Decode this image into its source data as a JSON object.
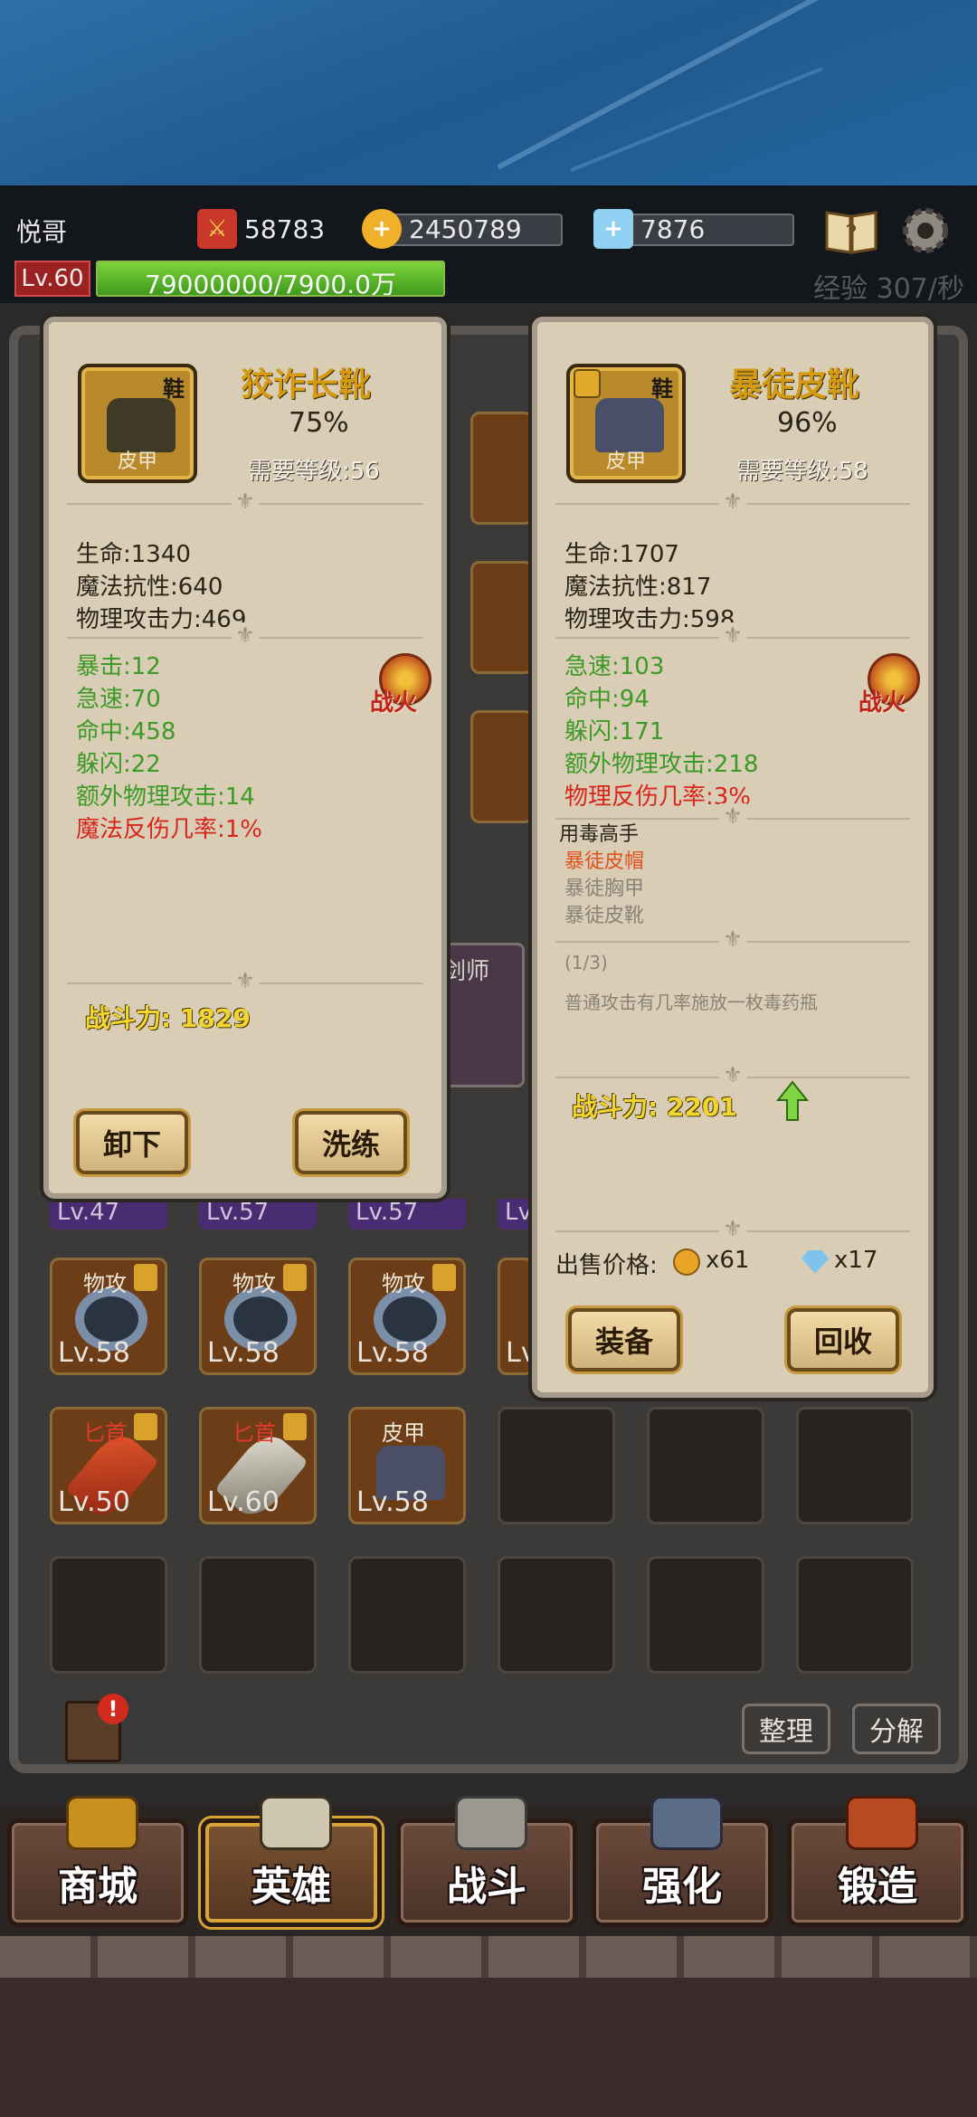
{
  "player": {
    "name": "悦哥",
    "level": "Lv.60",
    "exp_text": "79000000/7900.0万",
    "exp_fraction": 1.0,
    "exp_rate": "经验 307/秒"
  },
  "resources": {
    "power": "58783",
    "gold": "2450789",
    "diamond": "7876"
  },
  "left_card": {
    "title": "狡诈长靴",
    "percent": "75%",
    "required_level": "需要等级:56",
    "slot": "鞋",
    "type": "皮甲",
    "base_stats": [
      "生命:1340",
      "魔法抗性:640",
      "物理攻击力:469"
    ],
    "bonus_stats": [
      "暴击:12",
      "急速:70",
      "命中:458",
      "躲闪:22",
      "额外物理攻击:14"
    ],
    "red_stats": [
      "魔法反伤几率:1%"
    ],
    "fire_label": "战火",
    "power": "战斗力: 1829",
    "buttons": {
      "unequip": "卸下",
      "refine": "洗练"
    }
  },
  "right_card": {
    "title": "暴徒皮靴",
    "percent": "96%",
    "required_level": "需要等级:58",
    "slot": "鞋",
    "type": "皮甲",
    "base_stats": [
      "生命:1707",
      "魔法抗性:817",
      "物理攻击力:598"
    ],
    "bonus_stats": [
      "急速:103",
      "命中:94",
      "躲闪:171",
      "额外物理攻击:218"
    ],
    "red_stats": [
      "物理反伤几率:3%"
    ],
    "fire_label": "战火",
    "set": {
      "name": "用毒高手",
      "pieces": [
        "暴徒皮帽",
        "暴徒胸甲",
        "暴徒皮靴"
      ],
      "progress": "(1/3)",
      "effect": "普通攻击有几率施放一枚毒药瓶"
    },
    "power": "战斗力: 2201",
    "sell_label": "出售价格:",
    "sell_gold": "x61",
    "sell_diamond": "x17",
    "buttons": {
      "equip": "装备",
      "recycle": "回收"
    }
  },
  "inventory": {
    "level_tabs": [
      "Lv.47",
      "Lv.57",
      "Lv.57",
      "Lv"
    ],
    "row1": [
      {
        "tag": "物攻",
        "level": "Lv.58",
        "locked": true
      },
      {
        "tag": "物攻",
        "level": "Lv.58",
        "locked": true
      },
      {
        "tag": "物攻",
        "level": "Lv.58",
        "locked": true
      },
      {
        "tag": "",
        "level": "Lv",
        "locked": false
      }
    ],
    "row2": [
      {
        "tag": "匕首",
        "level": "Lv.50",
        "locked": true
      },
      {
        "tag": "匕首",
        "level": "Lv.60",
        "locked": true
      },
      {
        "tag": "皮甲",
        "level": "Lv.58",
        "locked": false
      }
    ],
    "sort_label": "整理",
    "decompose_label": "分解",
    "hero_label": "剑师"
  },
  "nav": [
    {
      "label": "商城",
      "icon": "treasure-chest-icon"
    },
    {
      "label": "英雄",
      "icon": "knight-helmet-icon"
    },
    {
      "label": "战斗",
      "icon": "crossed-swords-icon"
    },
    {
      "label": "强化",
      "icon": "hammer-icon"
    },
    {
      "label": "锻造",
      "icon": "anvil-icon"
    }
  ],
  "colors": {
    "accent_gold": "#d49b12",
    "green_stat": "#3e9a26",
    "red_stat": "#d8261b",
    "exp_green": "#7cd33b",
    "level_red": "#9a2222"
  }
}
